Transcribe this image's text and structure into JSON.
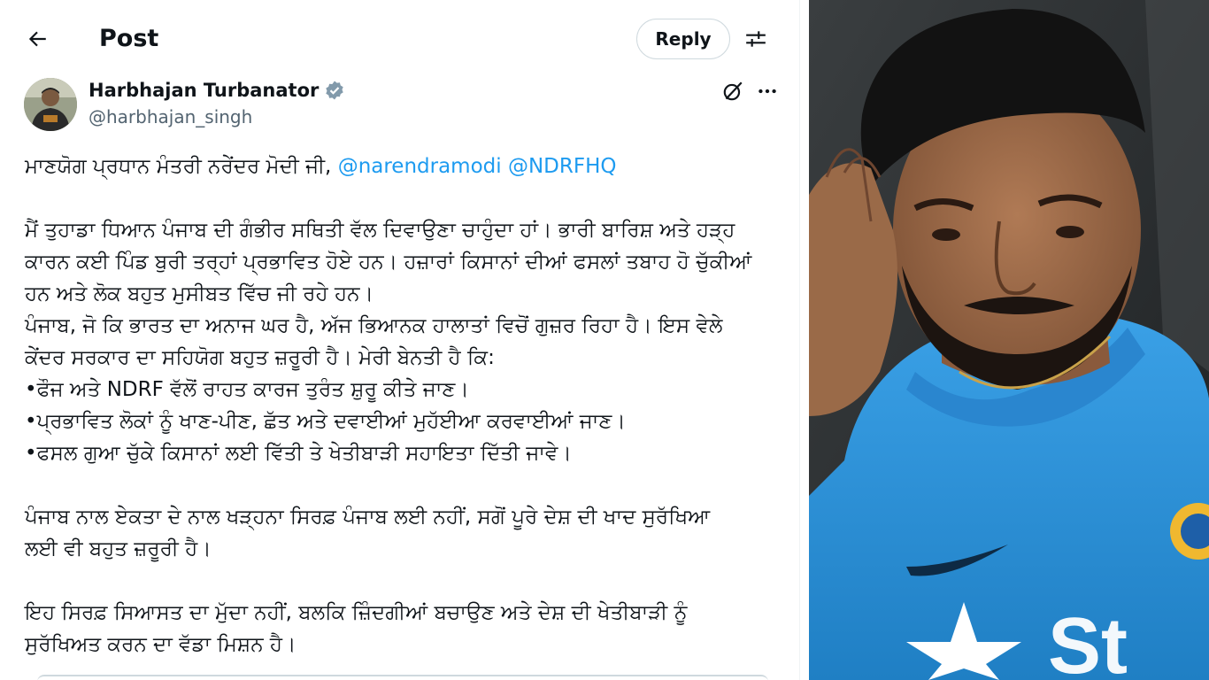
{
  "header": {
    "title": "Post",
    "reply_label": "Reply"
  },
  "author": {
    "name": "Harbhajan Turbanator",
    "handle": "@harbhajan_singh"
  },
  "post": {
    "line1_text": "ਮਾਣਯੋਗ ਪ੍ਰਧਾਨ ਮੰਤਰੀ ਨਰੇਂਦਰ ਮੋਦੀ ਜੀ, ",
    "mention1": "@narendramodi",
    "mention2": "@NDRFHQ",
    "line3": "ਮੈਂ ਤੁਹਾਡਾ ਧਿਆਨ ਪੰਜਾਬ ਦੀ ਗੰਭੀਰ ਸਥਿਤੀ ਵੱਲ ਦਿਵਾਉਣਾ ਚਾਹੁੰਦਾ ਹਾਂ। ਭਾਰੀ ਬਾਰਿਸ਼ ਅਤੇ ਹੜ੍ਹ",
    "line4": "ਕਾਰਨ ਕਈ ਪਿੰਡ ਬੁਰੀ ਤਰ੍ਹਾਂ ਪ੍ਰਭਾਵਿਤ ਹੋਏ ਹਨ। ਹਜ਼ਾਰਾਂ ਕਿਸਾਨਾਂ ਦੀਆਂ ਫਸਲਾਂ ਤਬਾਹ ਹੋ ਚੁੱਕੀਆਂ",
    "line5": "ਹਨ ਅਤੇ ਲੋਕ ਬਹੁਤ ਮੁਸੀਬਤ ਵਿੱਚ ਜੀ ਰਹੇ ਹਨ।",
    "line6": "ਪੰਜਾਬ, ਜੋ ਕਿ ਭਾਰਤ ਦਾ ਅਨਾਜ ਘਰ ਹੈ, ਅੱਜ ਭਿਆਨਕ ਹਾਲਾਤਾਂ ਵਿਚੋਂ ਗੁਜ਼ਰ ਰਿਹਾ ਹੈ। ਇਸ ਵੇਲੇ",
    "line7": "ਕੇਂਦਰ ਸਰਕਾਰ ਦਾ ਸਹਿਯੋਗ ਬਹੁਤ ਜ਼ਰੂਰੀ ਹੈ। ਮੇਰੀ ਬੇਨਤੀ ਹੈ ਕਿ:",
    "line8": "•ਫੌਜ ਅਤੇ NDRF ਵੱਲੋਂ ਰਾਹਤ ਕਾਰਜ ਤੁਰੰਤ ਸ਼ੁਰੂ ਕੀਤੇ ਜਾਣ।",
    "line9": "•ਪ੍ਰਭਾਵਿਤ ਲੋਕਾਂ ਨੂੰ ਖਾਣ-ਪੀਣ, ਛੱਤ ਅਤੇ ਦਵਾਈਆਂ ਮੁਹੱਈਆ ਕਰਵਾਈਆਂ ਜਾਣ।",
    "line10": "•ਫਸਲ ਗੁਆ ਚੁੱਕੇ ਕਿਸਾਨਾਂ ਲਈ ਵਿੱਤੀ ਤੇ ਖੇਤੀਬਾੜੀ ਸਹਾਇਤਾ ਦਿੱਤੀ ਜਾਵੇ।",
    "line12": "ਪੰਜਾਬ ਨਾਲ ਏਕਤਾ ਦੇ ਨਾਲ ਖੜ੍ਹਨਾ ਸਿਰਫ਼ ਪੰਜਾਬ ਲਈ ਨਹੀਂ, ਸਗੋਂ ਪੂਰੇ ਦੇਸ਼ ਦੀ ਖਾਦ ਸੁਰੱਖਿਆ",
    "line13": "ਲਈ ਵੀ ਬਹੁਤ ਜ਼ਰੂਰੀ ਹੈ।",
    "line15": "ਇਹ ਸਿਰਫ਼ ਸਿਆਸਤ ਦਾ ਮੁੱਦਾ ਨਹੀਂ, ਬਲਕਿ ਜ਼ਿੰਦਗੀਆਂ ਬਚਾਉਣ ਅਤੇ ਦੇਸ਼ ਦੀ ਖੇਤੀਬਾੜੀ ਨੂੰ",
    "line16": "ਸੁਰੱਖਿਅਤ ਕਰਨ ਦਾ ਵੱਡਾ ਮਿਸ਼ਨ ਹੈ।"
  },
  "icons": {
    "back": "arrow-left-icon",
    "settings": "sliders-icon",
    "verified": "verified-badge-icon",
    "grok": "grok-icon",
    "more": "more-horizontal-icon"
  },
  "colors": {
    "mention": "#1d9bf0",
    "verified": "#829aab",
    "jersey": "#2b8fd6"
  }
}
